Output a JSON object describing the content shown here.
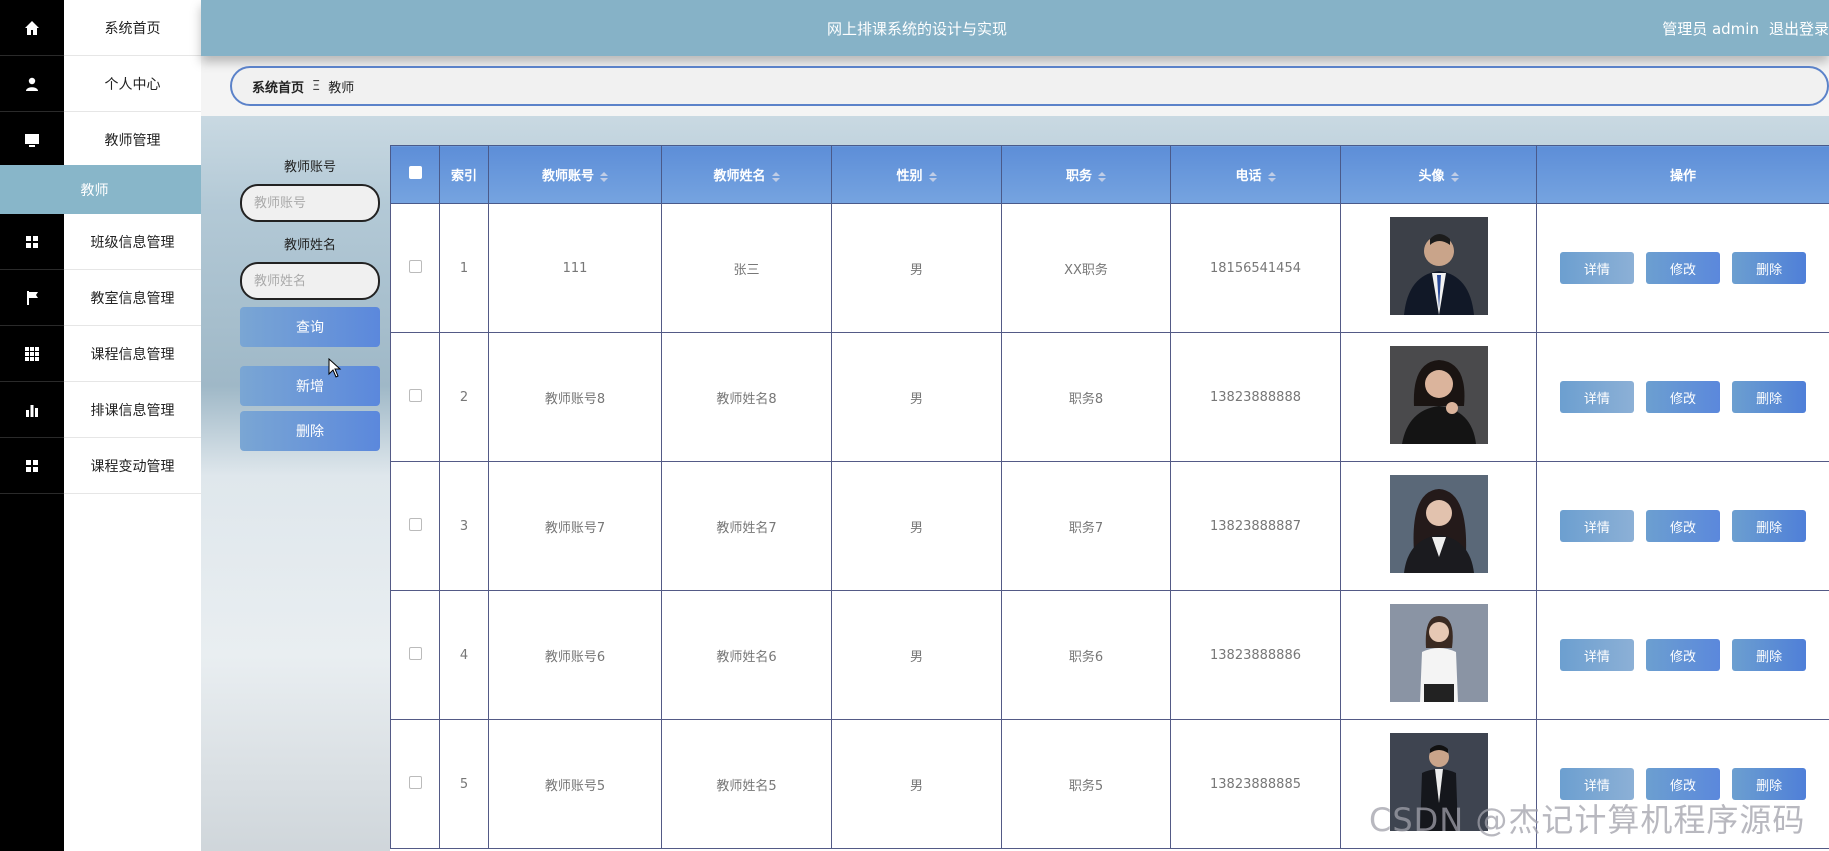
{
  "app": {
    "title": "网上排课系统的设计与实现",
    "user_label": "管理员 admin",
    "logout_label": "退出登录"
  },
  "sidebar": {
    "items": [
      {
        "label": "系统首页",
        "icon": "home-icon"
      },
      {
        "label": "个人中心",
        "icon": "user-icon"
      },
      {
        "label": "教师管理",
        "icon": "monitor-icon"
      },
      {
        "label": "班级信息管理",
        "icon": "grid-icon"
      },
      {
        "label": "教室信息管理",
        "icon": "flag-icon"
      },
      {
        "label": "课程信息管理",
        "icon": "apps-icon"
      },
      {
        "label": "排课信息管理",
        "icon": "bar-chart-icon"
      },
      {
        "label": "课程变动管理",
        "icon": "grid-icon"
      }
    ],
    "sub_item": "教师"
  },
  "breadcrumb": {
    "home": "系统首页",
    "separator": "Ξ",
    "current": "教师"
  },
  "search": {
    "account_label": "教师账号",
    "account_placeholder": "教师账号",
    "name_label": "教师姓名",
    "name_placeholder": "教师姓名",
    "query_button": "查询",
    "add_button": "新增",
    "delete_button": "删除"
  },
  "table": {
    "headers": {
      "index": "索引",
      "account": "教师账号",
      "name": "教师姓名",
      "gender": "性别",
      "position": "职务",
      "phone": "电话",
      "avatar": "头像",
      "actions": "操作"
    },
    "rows": [
      {
        "index": "1",
        "account": "111",
        "name": "张三",
        "gender": "男",
        "position": "XX职务",
        "phone": "18156541454"
      },
      {
        "index": "2",
        "account": "教师账号8",
        "name": "教师姓名8",
        "gender": "男",
        "position": "职务8",
        "phone": "13823888888"
      },
      {
        "index": "3",
        "account": "教师账号7",
        "name": "教师姓名7",
        "gender": "男",
        "position": "职务7",
        "phone": "13823888887"
      },
      {
        "index": "4",
        "account": "教师账号6",
        "name": "教师姓名6",
        "gender": "男",
        "position": "职务6",
        "phone": "13823888886"
      },
      {
        "index": "5",
        "account": "教师账号5",
        "name": "教师姓名5",
        "gender": "男",
        "position": "职务5",
        "phone": "13823888885"
      }
    ],
    "action_labels": {
      "detail": "详情",
      "edit": "修改",
      "delete": "删除"
    }
  },
  "watermark": "CSDN @杰记计算机程序源码",
  "colors": {
    "header": "#86b2c7",
    "sidebar_icons_bg": "#000000",
    "active_sub": "#88b6c9",
    "table_header": "#5d8ed8",
    "breadcrumb_border": "#5b82c9"
  }
}
